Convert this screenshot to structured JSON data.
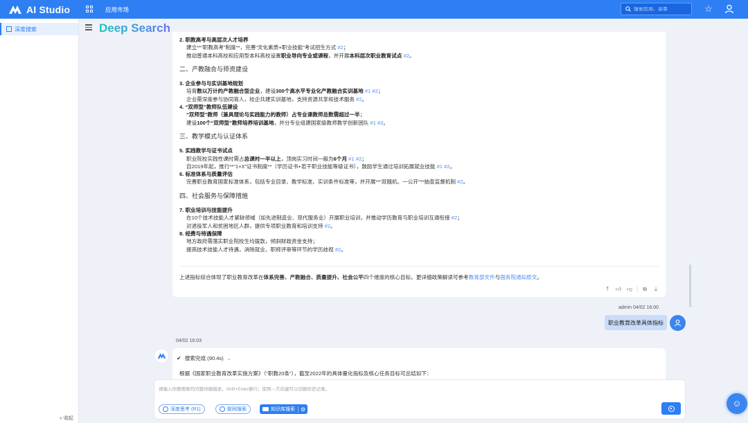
{
  "topbar": {
    "app_name": "AI Studio",
    "nav_market": "应用市场",
    "search_placeholder": "搜索应用、菜单"
  },
  "sidebar": {
    "items": [
      {
        "label": "深度搜索",
        "active": true
      }
    ],
    "collapse_label": "收起"
  },
  "main": {
    "title": "Deep Search"
  },
  "answer1": {
    "items": [
      {
        "num": "2.",
        "title": "职教高考与高层次人才培养",
        "lines": [
          {
            "parts": [
              {
                "t": "建立**“职教高考”制度**，完善“文化素质+职业技能”考试招生方式 "
              },
              {
                "r": "#2"
              },
              {
                "t": "；"
              }
            ]
          },
          {
            "parts": [
              {
                "t": "推动普通本科高校和应用型本科高校设置"
              },
              {
                "b": "职业导向专业或课程"
              },
              {
                "t": "，并开展"
              },
              {
                "b": "本科层次职业教育试点"
              },
              {
                "t": " "
              },
              {
                "r": "#2"
              },
              {
                "t": "。"
              }
            ]
          }
        ]
      },
      {
        "section": "二、产教融合与师资建设"
      },
      {
        "num": "3.",
        "title": "企业参与与实训基地规划",
        "lines": [
          {
            "parts": [
              {
                "t": "培育"
              },
              {
                "b": "数以万计的产教融合型企业"
              },
              {
                "t": "，建设"
              },
              {
                "b": "300个高水平专业化产教融合实训基地"
              },
              {
                "t": " "
              },
              {
                "r": "#1"
              },
              {
                "t": " "
              },
              {
                "r": "#2"
              },
              {
                "t": "；"
              }
            ]
          },
          {
            "parts": [
              {
                "t": "企业需深度参与协同育人，校企共建实训基地，支持资源共享和技术服务 "
              },
              {
                "r": "#2"
              },
              {
                "t": "。"
              }
            ]
          }
        ]
      },
      {
        "num": "4.",
        "title": "“双师型”教师队伍建设",
        "lines": [
          {
            "parts": [
              {
                "b": "“双师型”教师（兼具理论与实践能力的教师）占专业课教师总数需超过一半"
              },
              {
                "t": "；"
              }
            ]
          },
          {
            "parts": [
              {
                "t": "建设"
              },
              {
                "b": "100个“双师型”教师培养培训基地"
              },
              {
                "t": "，并分专业组建国家级教师教学创新团队 "
              },
              {
                "r": "#1"
              },
              {
                "t": " "
              },
              {
                "r": "#2"
              },
              {
                "t": "。"
              }
            ]
          }
        ]
      },
      {
        "section": "三、教学模式与认证体系"
      },
      {
        "num": "5.",
        "title": "实践教学与证书试点",
        "lines": [
          {
            "parts": [
              {
                "t": "职业院校实践性课时需占"
              },
              {
                "b": "总课时一半以上"
              },
              {
                "t": "，顶岗实习时间一般为"
              },
              {
                "b": "6个月"
              },
              {
                "t": " "
              },
              {
                "r": "#1"
              },
              {
                "t": " "
              },
              {
                "r": "#2"
              },
              {
                "t": "；"
              }
            ]
          },
          {
            "parts": [
              {
                "t": "自2019年起，推行**“1+X”证书制度**（学历证书+若干职业技能等级证书），鼓励学生通过培训拓展就业技能 "
              },
              {
                "r": "#1"
              },
              {
                "t": " "
              },
              {
                "r": "#2"
              },
              {
                "t": "。"
              }
            ]
          }
        ]
      },
      {
        "num": "6.",
        "title": "标准体系与质量评估",
        "lines": [
          {
            "parts": [
              {
                "t": "完善职业教育国家标准体系，包括专业目录、教学标准、实训条件标准等，并开展**“双随机、一公开”**抽查监督机制 "
              },
              {
                "r": "#2"
              },
              {
                "t": "。"
              }
            ]
          }
        ]
      },
      {
        "section": "四、社会服务与保障措施"
      },
      {
        "num": "7.",
        "title": "职业培训与技能提升",
        "lines": [
          {
            "parts": [
              {
                "t": "在10个技术技能人才紧缺领域（如先进制造业、现代服务业）开展职业培训，并推动学历教育与职业培训互通衔接 "
              },
              {
                "r": "#2"
              },
              {
                "t": "；"
              }
            ]
          },
          {
            "parts": [
              {
                "t": "对退役军人和贫困地区人群，提供专项职业教育和培训支持 "
              },
              {
                "r": "#2"
              },
              {
                "t": "。"
              }
            ]
          }
        ]
      },
      {
        "num": "8.",
        "title": "经费与待遇保障",
        "lines": [
          {
            "parts": [
              {
                "t": "地方政府需落实职业院校生均拨款，倾斜财政资金支持；"
              }
            ]
          },
          {
            "parts": [
              {
                "t": "提高技术技能人才待遇，消除就业、职称评审等环节的学历歧视 "
              },
              {
                "r": "#2"
              },
              {
                "t": "。"
              }
            ]
          }
        ]
      }
    ],
    "summary": [
      {
        "t": "上述指标综合体现了职业教育改革在"
      },
      {
        "b": "体系完善、产教融合、质量提升、社会公平"
      },
      {
        "t": "四个维度的核心目标。更详细政策解读可参考"
      },
      {
        "l": "教育部文件"
      },
      {
        "t": "与"
      },
      {
        "l": "国务院通知原文"
      },
      {
        "t": "。"
      }
    ]
  },
  "user_msg": {
    "meta": "admin 04/02 16:00",
    "text": "职业教育改革具体指标"
  },
  "answer2": {
    "time": "04/02 16:03",
    "status": "搜索完成 (90.4s)",
    "intro": "根据《国家职业教育改革实施方案》（“职教20条”），截至2022年的具体量化指标及核心任务目标可总结如下："
  },
  "input": {
    "placeholder": "请输入你要搜索的问题详细描述，Shift+Enter换行；使用↑↓方向键可以切换历史记录。",
    "btn_deep": "深度思考 (R1)",
    "btn_web": "联网搜索",
    "btn_kb": "知识库搜索"
  },
  "colors": {
    "primary": "#2d7ff3",
    "link": "#4a8ef5",
    "user_bubble": "#c9dcf9",
    "bg": "#eef2f8"
  }
}
